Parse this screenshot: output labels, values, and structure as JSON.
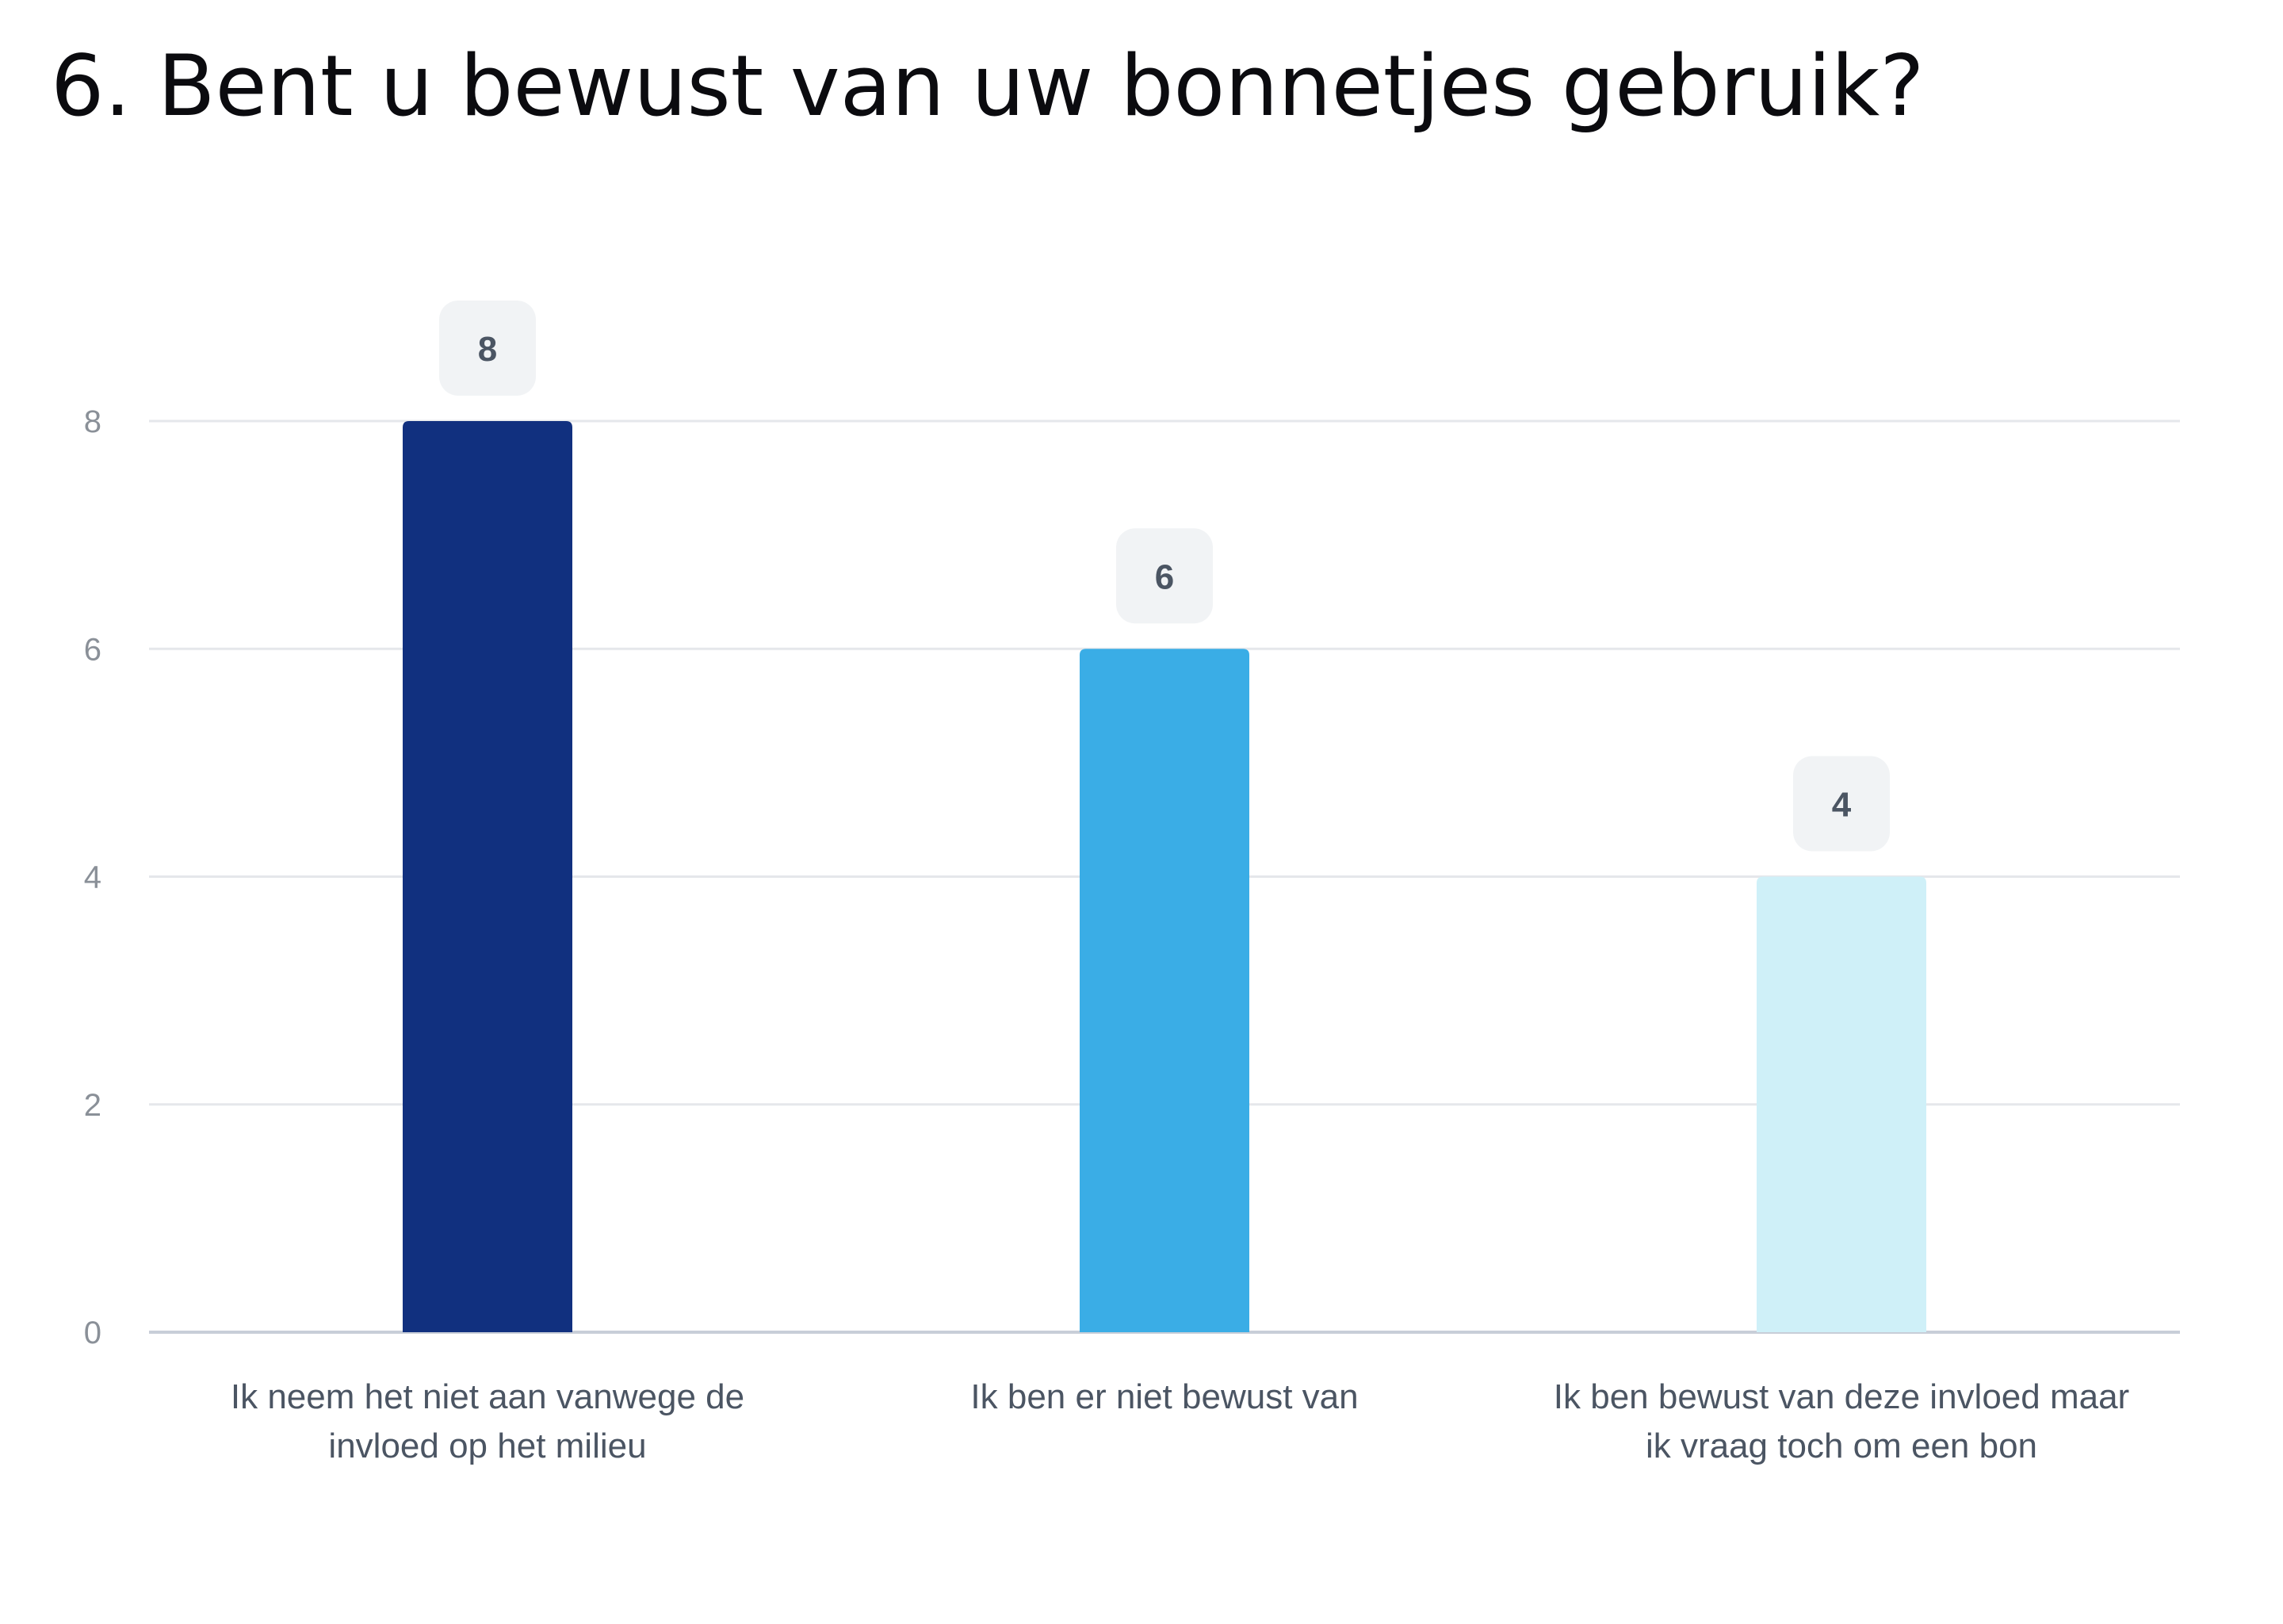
{
  "chart_data": {
    "type": "bar",
    "title": "6. Bent u bewust van uw bonnetjes gebruik?",
    "xlabel": "",
    "ylabel": "",
    "ylim": [
      0,
      8
    ],
    "yticks": [
      0,
      2,
      4,
      6,
      8
    ],
    "grid": true,
    "categories": [
      [
        "Ik neem het niet aan vanwege de",
        "invloed op het milieu"
      ],
      [
        "Ik ben er niet bewust van"
      ],
      [
        "Ik ben bewust van deze invloed maar",
        "ik vraag toch om een bon"
      ]
    ],
    "values": [
      8,
      6,
      4
    ],
    "colors": [
      "#11307f",
      "#3aade6",
      "#cff0f8"
    ],
    "label_badge_color": "#f1f3f5",
    "grid_color": "#e5e7eb",
    "axis_color": "#c8ced8"
  }
}
